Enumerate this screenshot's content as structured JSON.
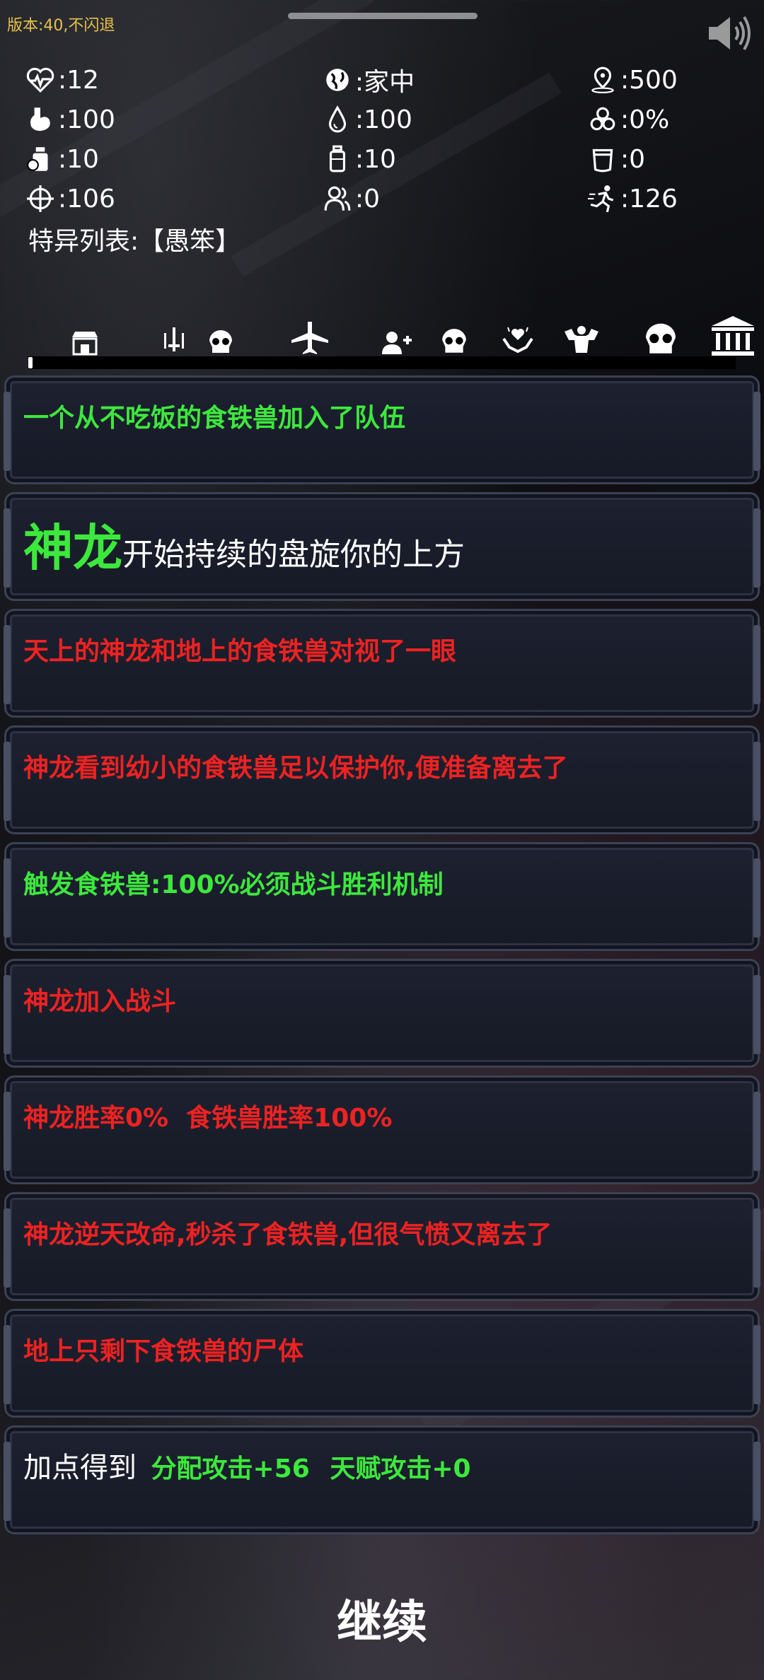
{
  "version": "版本:40,不闪退",
  "stats": [
    [
      {
        "icon": "heartbeat-icon",
        "value": ":12"
      },
      {
        "icon": "earth-icon",
        "value": ":家中"
      },
      {
        "icon": "location-pin-icon",
        "value": ":500"
      }
    ],
    [
      {
        "icon": "stomach-icon",
        "value": ":100"
      },
      {
        "icon": "water-drop-icon",
        "value": ":100"
      },
      {
        "icon": "biohazard-icon",
        "value": ":0%"
      }
    ],
    [
      {
        "icon": "food-jar-icon",
        "value": ":10"
      },
      {
        "icon": "water-bottle-icon",
        "value": ":10"
      },
      {
        "icon": "mug-icon",
        "value": ":0"
      }
    ],
    [
      {
        "icon": "crosshair-icon",
        "value": ":106"
      },
      {
        "icon": "team-icon",
        "value": ":0"
      },
      {
        "icon": "running-man-icon",
        "value": ":126"
      }
    ]
  ],
  "special": "特异列表:【愚笨】",
  "toolbar": [
    "shop-icon",
    "weapons-icon",
    "skull-icon",
    "plane-icon",
    "add-user-icon",
    "skull-icon",
    "hand-heart-icon",
    "strength-icon",
    "skull-icon",
    "bank-icon"
  ],
  "messages": {
    "m1": "一个从不吃饭的食铁兽加入了队伍",
    "m2_big": "神龙",
    "m2_rest": "开始持续的盘旋你的上方",
    "m3": "天上的神龙和地上的食铁兽对视了一眼",
    "m4": "神龙看到幼小的食铁兽足以保护你,便准备离去了",
    "m5": "触发食铁兽:100%必须战斗胜利机制",
    "m6": "神龙加入战斗",
    "m7": "神龙胜率0%  食铁兽胜率100%",
    "m8": "神龙逆天改命,秒杀了食铁兽,但很气愤又离去了",
    "m9": "地上只剩下食铁兽的尸体",
    "m10_prefix": "加点得到",
    "m10_a": "分配攻击+56",
    "m10_b": "天赋攻击+0"
  },
  "continue_label": "继续",
  "colors": {
    "green": "#3de83d",
    "red": "#ee2222",
    "version": "#e6c24a"
  }
}
